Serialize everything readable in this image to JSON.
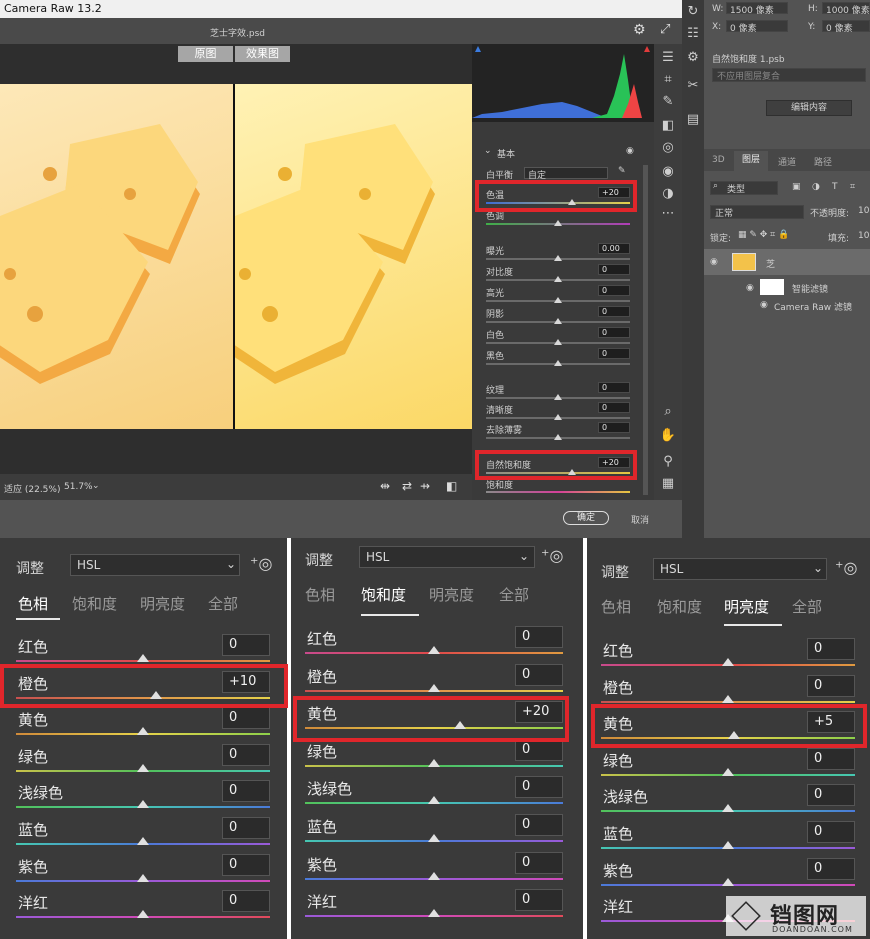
{
  "app": {
    "title": "Camera Raw 13.2",
    "file": "芝士字效.psd"
  },
  "compare": {
    "before": "原图",
    "after": "效果图"
  },
  "footer": {
    "fit": "适应 (22.5%)",
    "zoom": "51.7%",
    "ok": "确定",
    "cancel": "取消"
  },
  "basic": {
    "section": "基本",
    "wb_label": "白平衡",
    "wb_value": "自定",
    "rows": [
      {
        "label": "色温",
        "value": "+20"
      },
      {
        "label": "色调",
        "value": ""
      },
      {
        "label": "曝光",
        "value": "0.00"
      },
      {
        "label": "对比度",
        "value": "0"
      },
      {
        "label": "高光",
        "value": "0"
      },
      {
        "label": "阴影",
        "value": "0"
      },
      {
        "label": "白色",
        "value": "0"
      },
      {
        "label": "黑色",
        "value": "0"
      },
      {
        "label": "纹理",
        "value": "0"
      },
      {
        "label": "清晰度",
        "value": "0"
      },
      {
        "label": "去除薄雾",
        "value": "0"
      },
      {
        "label": "自然饱和度",
        "value": "+20"
      },
      {
        "label": "饱和度",
        "value": ""
      }
    ]
  },
  "ps": {
    "w_label": "W:",
    "w": "1500 像素",
    "h_label": "H:",
    "h": "1000 像素",
    "x_label": "X:",
    "x": "0 像素",
    "y_label": "Y:",
    "y": "0 像素",
    "smart_name": "自然饱和度 1.psb",
    "smart_mode": "不应用图层复合",
    "edit": "编辑内容",
    "tabs": [
      "3D",
      "图层",
      "通道",
      "路径"
    ],
    "kind": "类型",
    "blend": "正常",
    "opacity_label": "不透明度:",
    "opacity": "10",
    "lock_label": "锁定:",
    "fill_label": "填充:",
    "fill": "10",
    "layer": "芝",
    "smart_filters": "智能滤镜",
    "filter": "Camera Raw 滤镜"
  },
  "hsl": {
    "adjust": "调整",
    "mode": "HSL",
    "tabs": [
      "色相",
      "饱和度",
      "明亮度",
      "全部"
    ],
    "colors": [
      "红色",
      "橙色",
      "黄色",
      "绿色",
      "浅绿色",
      "蓝色",
      "紫色",
      "洋红"
    ],
    "p1": [
      "0",
      "+10",
      "0",
      "0",
      "0",
      "0",
      "0",
      "0"
    ],
    "p2": [
      "0",
      "0",
      "+20",
      "0",
      "0",
      "0",
      "0",
      "0"
    ],
    "p3": [
      "0",
      "0",
      "+5",
      "0",
      "0",
      "0",
      "0",
      ""
    ]
  },
  "watermark": {
    "name": "铛图网",
    "url": "DOANDOAN.COM"
  }
}
